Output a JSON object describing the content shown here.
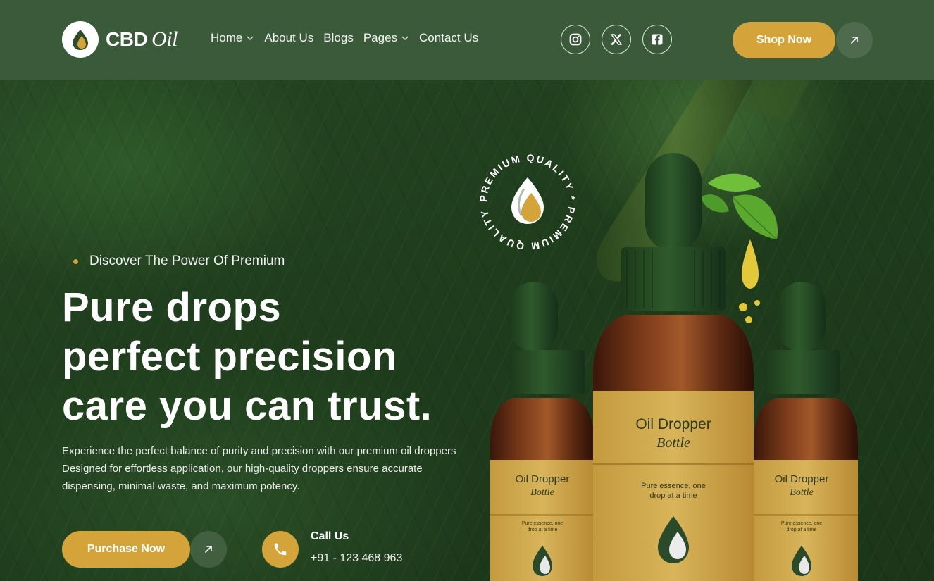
{
  "brand": {
    "name_strong": "CBD",
    "name_soft": "Oil",
    "logo_icon": "oil-drop-logo-icon"
  },
  "nav": {
    "items": [
      {
        "label": "Home",
        "has_dropdown": true
      },
      {
        "label": "About Us",
        "has_dropdown": false
      },
      {
        "label": "Blogs",
        "has_dropdown": false
      },
      {
        "label": "Pages",
        "has_dropdown": true
      },
      {
        "label": "Contact Us",
        "has_dropdown": false
      }
    ]
  },
  "social": [
    {
      "name": "instagram-icon"
    },
    {
      "name": "x-twitter-icon"
    },
    {
      "name": "facebook-icon"
    }
  ],
  "header_cta": {
    "label": "Shop Now",
    "arrow_icon": "arrow-up-right-icon"
  },
  "hero": {
    "eyebrow": "Discover The Power Of Premium",
    "headline_lines": [
      "Pure drops",
      "perfect precision",
      "care you can trust."
    ],
    "description": "Experience the perfect balance of purity and precision with our premium oil droppers Designed for effortless application, our high-quality droppers ensure accurate dispensing, minimal waste, and maximum potency.",
    "cta_label": "Purchase Now",
    "call_title": "Call Us",
    "call_number": "+91 - 123 468 963"
  },
  "badge": {
    "ring_text": "PREMIUM QUALITY * PREMIUM QUALITY * "
  },
  "bottles": {
    "title": "Oil Dropper",
    "subtitle": "Bottle",
    "tagline_line1": "Pure essence, one",
    "tagline_line2": "drop at a time"
  },
  "colors": {
    "header_bg": "#3b5a3a",
    "accent_gold": "#d4a43a",
    "hero_dark_green": "#23411f"
  }
}
